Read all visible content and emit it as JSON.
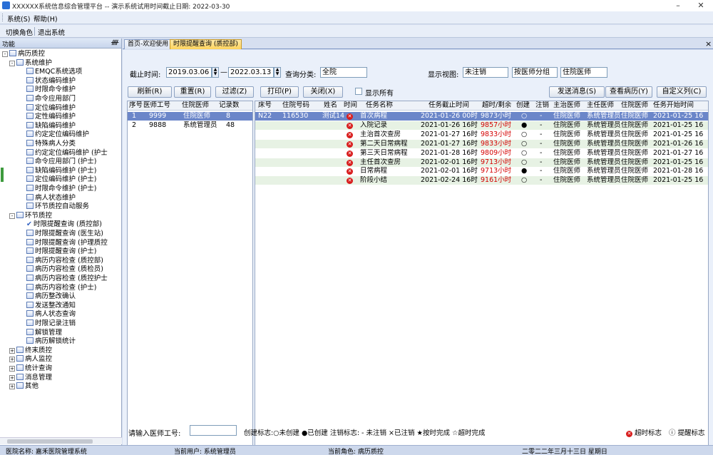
{
  "window": {
    "title": "XXXXXX系统信息综合管理平台 -- 演示系统试用时间截止日期: 2022-03-30",
    "minimize": "–",
    "close": "✕"
  },
  "menu": {
    "items": [
      "系统(S)",
      "帮助(H)"
    ]
  },
  "toolbar": {
    "items": [
      "切换角色",
      "退出系统"
    ]
  },
  "left_panel": {
    "header": "功能",
    "pin": "⬡",
    "tree": [
      {
        "label": "病历质控",
        "level": 0,
        "type": "folder",
        "expander": "-"
      },
      {
        "label": "系统维护",
        "level": 1,
        "type": "folder",
        "expander": "-"
      },
      {
        "label": "EMQC系统选项",
        "level": 2,
        "type": "item"
      },
      {
        "label": "状态编码维护",
        "level": 2,
        "type": "item"
      },
      {
        "label": "时限命令维护",
        "level": 2,
        "type": "item"
      },
      {
        "label": "命令应用部门",
        "level": 2,
        "type": "item"
      },
      {
        "label": "定位编码维护",
        "level": 2,
        "type": "item"
      },
      {
        "label": "定性编码维护",
        "level": 2,
        "type": "item"
      },
      {
        "label": "缺陷编码维护",
        "level": 2,
        "type": "item"
      },
      {
        "label": "约定定位编码维护",
        "level": 2,
        "type": "item"
      },
      {
        "label": "特殊病人分类",
        "level": 2,
        "type": "item"
      },
      {
        "label": "约定定位编码维护 (护士",
        "level": 2,
        "type": "item"
      },
      {
        "label": "命令应用部门 (护士)",
        "level": 2,
        "type": "item"
      },
      {
        "label": "缺陷编码维护 (护士)",
        "level": 2,
        "type": "item"
      },
      {
        "label": "定位编码维护 (护士)",
        "level": 2,
        "type": "item"
      },
      {
        "label": "时限命令维护 (护士)",
        "level": 2,
        "type": "item"
      },
      {
        "label": "病人状态维护",
        "level": 2,
        "type": "item"
      },
      {
        "label": "环节质控自动服务",
        "level": 2,
        "type": "item"
      },
      {
        "label": "环节质控",
        "level": 1,
        "type": "folder",
        "expander": "-"
      },
      {
        "label": "时限提醒查询 (质控部)",
        "level": 2,
        "type": "check"
      },
      {
        "label": "时限提醒查询 (医生站)",
        "level": 2,
        "type": "item"
      },
      {
        "label": "时限提醒查询 (护理质控",
        "level": 2,
        "type": "item"
      },
      {
        "label": "时限提醒查询 (护士)",
        "level": 2,
        "type": "item"
      },
      {
        "label": "病历内容检查 (质控部)",
        "level": 2,
        "type": "item"
      },
      {
        "label": "病历内容检查 (质检员)",
        "level": 2,
        "type": "item"
      },
      {
        "label": "病历内容检查 (质控护士",
        "level": 2,
        "type": "item"
      },
      {
        "label": "病历内容检查 (护士)",
        "level": 2,
        "type": "item"
      },
      {
        "label": "病历整改确认",
        "level": 2,
        "type": "item"
      },
      {
        "label": "发送整改通知",
        "level": 2,
        "type": "item"
      },
      {
        "label": "病人状态查询",
        "level": 2,
        "type": "item"
      },
      {
        "label": "时限记录注销",
        "level": 2,
        "type": "item"
      },
      {
        "label": "解锁管理",
        "level": 2,
        "type": "item"
      },
      {
        "label": "病历解锁统计",
        "level": 2,
        "type": "item"
      },
      {
        "label": "终末质控",
        "level": 1,
        "type": "folder",
        "expander": "+"
      },
      {
        "label": "病人监控",
        "level": 1,
        "type": "folder",
        "expander": "+"
      },
      {
        "label": "统计查询",
        "level": 1,
        "type": "folder",
        "expander": "+"
      },
      {
        "label": "消息管理",
        "level": 1,
        "type": "folder",
        "expander": "+"
      },
      {
        "label": "其他",
        "level": 1,
        "type": "folder",
        "expander": "+"
      }
    ]
  },
  "tabs": [
    {
      "label": "首页-欢迎使用",
      "active": false
    },
    {
      "label": "时限提醒查询 (质控部)",
      "active": true
    }
  ],
  "filters": {
    "deadline_label": "截止时间:",
    "date_from": "2019.03.06",
    "dash": "—",
    "date_to": "2022.03.13",
    "query_type_label": "查询分类:",
    "query_type_value": "全院",
    "view_label": "显示视图:",
    "view_value": "未注销",
    "group_value": "按医师分组",
    "doctor_value": "住院医师"
  },
  "buttons": {
    "refresh": "刷新(R)",
    "reset": "重置(R)",
    "filter": "过滤(Z)",
    "print": "打印(P)",
    "close": "关闭(X)",
    "show_all": "显示所有",
    "send_msg": "发送消息(S)",
    "view_record": "查看病历(Y)",
    "custom_cols": "自定义列(C)"
  },
  "left_grid": {
    "columns": [
      "序号",
      "医师工号",
      "住院医师",
      "记录数"
    ],
    "rows": [
      {
        "seq": "1",
        "id": "9999",
        "name": "住院医师",
        "count": "8",
        "selected": true
      },
      {
        "seq": "2",
        "id": "9888",
        "name": "系统管理员",
        "count": "48",
        "selected": false
      }
    ]
  },
  "right_grid": {
    "columns": [
      "床号",
      "住院号码",
      "姓名",
      "时间",
      "任务名称",
      "任务截止时间",
      "超时/剩余",
      "创建",
      "注销",
      "主治医师",
      "主任医师",
      "住院医师",
      "任务开始时间"
    ],
    "rows": [
      {
        "bed": "N22",
        "no": "116530",
        "name": "测试14",
        "task": "首次病程",
        "deadline": "2021-01-26 00时",
        "remain": "9873小时",
        "create": "○",
        "cancel": "-",
        "attending": "住院医师",
        "director": "系统管理员",
        "resident": "住院医师",
        "start": "2021-01-25 16",
        "selected": true
      },
      {
        "bed": "",
        "no": "",
        "name": "",
        "task": "入院记录",
        "deadline": "2021-01-26 16时",
        "remain": "9857小时",
        "create": "●",
        "cancel": "-",
        "attending": "住院医师",
        "director": "系统管理员",
        "resident": "住院医师",
        "start": "2021-01-25 16",
        "selected": false
      },
      {
        "bed": "",
        "no": "",
        "name": "",
        "task": "主治首次查房",
        "deadline": "2021-01-27 16时",
        "remain": "9833小时",
        "create": "○",
        "cancel": "-",
        "attending": "住院医师",
        "director": "系统管理员",
        "resident": "住院医师",
        "start": "2021-01-25 16",
        "selected": false
      },
      {
        "bed": "",
        "no": "",
        "name": "",
        "task": "第二天日常病程",
        "deadline": "2021-01-27 16时",
        "remain": "9833小时",
        "create": "○",
        "cancel": "-",
        "attending": "住院医师",
        "director": "系统管理员",
        "resident": "住院医师",
        "start": "2021-01-26 16",
        "selected": false
      },
      {
        "bed": "",
        "no": "",
        "name": "",
        "task": "第三天日常病程",
        "deadline": "2021-01-28 16时",
        "remain": "9809小时",
        "create": "○",
        "cancel": "-",
        "attending": "住院医师",
        "director": "系统管理员",
        "resident": "住院医师",
        "start": "2021-01-27 16",
        "selected": false
      },
      {
        "bed": "",
        "no": "",
        "name": "",
        "task": "主任首次查房",
        "deadline": "2021-02-01 16时",
        "remain": "9713小时",
        "create": "○",
        "cancel": "-",
        "attending": "住院医师",
        "director": "系统管理员",
        "resident": "住院医师",
        "start": "2021-01-25 16",
        "selected": false
      },
      {
        "bed": "",
        "no": "",
        "name": "",
        "task": "日常病程",
        "deadline": "2021-02-01 16时",
        "remain": "9713小时",
        "create": "●",
        "cancel": "-",
        "attending": "住院医师",
        "director": "系统管理员",
        "resident": "住院医师",
        "start": "2021-01-28 16",
        "selected": false
      },
      {
        "bed": "",
        "no": "",
        "name": "",
        "task": "阶段小结",
        "deadline": "2021-02-24 16时",
        "remain": "9161小时",
        "create": "○",
        "cancel": "-",
        "attending": "住院医师",
        "director": "系统管理员",
        "resident": "住院医师",
        "start": "2021-01-25 16",
        "selected": false
      }
    ]
  },
  "bottom": {
    "doctor_id_label": "请输入医师工号:",
    "legend": "创建标志:○未创建 ●已创建  注销标志: - 未注销 ×已注销 ★按时完成 ☆超时完成",
    "timeout_flag": "超时标志",
    "remind_flag": "提醒标志"
  },
  "status": {
    "hospital": "医院名称: 嘉禾医院管理系统",
    "user": "当前用户: 系统管理员",
    "role": "当前角色: 病历质控",
    "date": "二零二二年三月十三日 星期日"
  },
  "colors": {
    "selected_row": "#6b86c9",
    "alt_row": "#e7f2e4",
    "timeout_red": "#d40000",
    "active_tab": "#ffd35c"
  }
}
